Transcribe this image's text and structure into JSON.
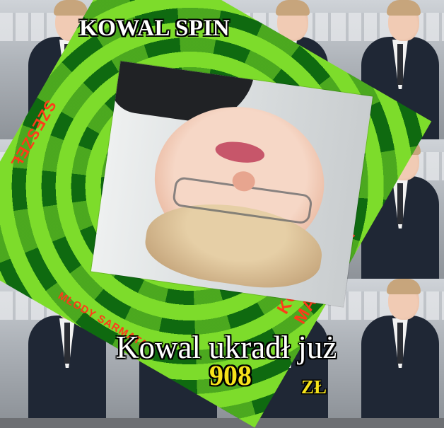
{
  "app": {
    "title": "KOWAL SPIN"
  },
  "board": {
    "edge_text_top": "SZESZEŁ",
    "edge_text_left": "MŁODY SARMATA",
    "edge_text_bottom": "KORWIN-MIKKE MAŁOLETNI"
  },
  "counter": {
    "label": "Kowal ukradł już",
    "value": "908",
    "currency": "ZŁ"
  },
  "colors": {
    "swirl_light": "#7ddc2b",
    "swirl_dark": "#0f6a10",
    "accent_text": "#ff3a1a",
    "counter_yellow": "#f6e31a"
  }
}
